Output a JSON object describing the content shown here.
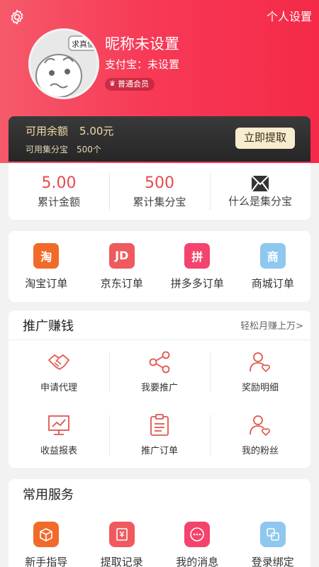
{
  "header": {
    "settings_link": "个人设置",
    "nickname": "昵称未设置",
    "alipay": "支付宝：未设置",
    "member_badge": "普通会员",
    "avatar_bubble": "求真像"
  },
  "balance": {
    "available_label": "可用余额",
    "available_amount": "5.00元",
    "points_label": "可用集分宝",
    "points_amount": "500个",
    "withdraw_button": "立即提取"
  },
  "stats": [
    {
      "value": "5.00",
      "label": "累计金额"
    },
    {
      "value": "500",
      "label": "累计集分宝"
    },
    {
      "label": "什么是集分宝",
      "icon": "envelope-icon"
    }
  ],
  "orders": [
    {
      "label": "淘宝订单",
      "glyph": "淘",
      "color": "#f26a2a",
      "icon": "taobao-icon"
    },
    {
      "label": "京东订单",
      "glyph": "JD",
      "color": "#ef5a5e",
      "icon": "jd-icon"
    },
    {
      "label": "拼多多订单",
      "glyph": "拼",
      "color": "#f4436c",
      "icon": "pinduoduo-icon"
    },
    {
      "label": "商城订单",
      "glyph": "商",
      "color": "#8ec8ef",
      "icon": "mall-icon"
    }
  ],
  "promo": {
    "title": "推广赚钱",
    "more": "轻松月赚上万>",
    "items": [
      {
        "label": "申请代理",
        "icon": "handshake-icon"
      },
      {
        "label": "我要推广",
        "icon": "share-icon"
      },
      {
        "label": "奖励明细",
        "icon": "user-heart-icon"
      },
      {
        "label": "收益报表",
        "icon": "chart-board-icon"
      },
      {
        "label": "推广订单",
        "icon": "clipboard-icon"
      },
      {
        "label": "我的粉丝",
        "icon": "fans-icon"
      }
    ]
  },
  "services": {
    "title": "常用服务",
    "items": [
      {
        "label": "新手指导",
        "icon": "gift-box-icon",
        "color": "#f26a2a"
      },
      {
        "label": "提取记录",
        "icon": "withdraw-record-icon",
        "color": "#ef5a5e"
      },
      {
        "label": "我的消息",
        "icon": "message-icon",
        "color": "#f4436c"
      },
      {
        "label": "登录绑定",
        "icon": "bind-icon",
        "color": "#8ec8ef"
      }
    ]
  },
  "colors": {
    "accent": "#f42a48",
    "stat_number": "#e54b50",
    "icon_line": "#e0564f"
  }
}
